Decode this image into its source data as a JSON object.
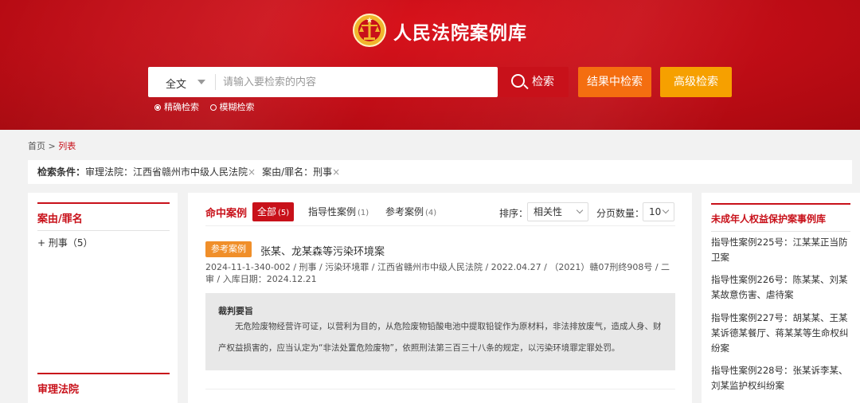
{
  "header": {
    "site_title": "人民法院案例库",
    "search_scope": "全文",
    "search_placeholder": "请输入要检索的内容",
    "search_button": "检索",
    "search_within_button": "结果中检索",
    "advanced_button": "高级检索",
    "match_options": [
      "精确检索",
      "模糊检索"
    ],
    "selected_match": "精确检索"
  },
  "breadcrumb": {
    "home": "首页",
    "sep": ">",
    "current": "列表"
  },
  "filters": {
    "label": "检索条件：",
    "conditions": [
      "审理法院：江西省赣州市中级人民法院",
      "案由/罪名：刑事"
    ],
    "remove_icon": "×"
  },
  "left_panel": {
    "section1_title": "案由/罪名",
    "section1_items": [
      "+ 刑事（5）"
    ],
    "section2_title": "审理法院"
  },
  "results": {
    "title": "命中案例",
    "tabs": [
      {
        "label": "全部",
        "count": "(5)"
      },
      {
        "label": "指导性案例",
        "count": "(1)"
      },
      {
        "label": "参考案例",
        "count": "(4)"
      }
    ],
    "sort_label": "排序：",
    "sort_value": "相关性",
    "page_size_label": "分页数量：",
    "page_size_value": "10",
    "items": [
      {
        "badge": "参考案例",
        "title": "张某、龙某森等污染环境案",
        "meta": "2024-11-1-340-002 / 刑事 / 污染环境罪 / 江西省赣州市中级人民法院 / 2022.04.27 / （2021）赣07刑终908号 / 二审 / 入库日期：2024.12.21",
        "summary_heading": "裁判要旨",
        "summary_text": "无危险废物经营许可证，以营利为目的，从危险废物铅酸电池中提取铅锭作为原材料，非法排放废气，造成人身、财产权益损害的，应当认定为“非法处置危险废物”，依照刑法第三百三十八条的规定，以污染环境罪定罪处罚。"
      }
    ]
  },
  "right_panel": {
    "title": "未成年人权益保护案事例库",
    "items": [
      "指导性案例225号：江某某正当防卫案",
      "指导性案例226号：陈某某、刘某某故意伤害、虐待案",
      "指导性案例227号：胡某某、王某某诉德某餐厅、蒋某某等生命权纠纷案",
      "指导性案例228号：张某诉李某、刘某监护权纠纷案"
    ]
  },
  "colors": {
    "brand_red": "#c8111a",
    "orange": "#f46e10",
    "amber": "#f6a000",
    "badge_orange": "#f08f2a"
  }
}
